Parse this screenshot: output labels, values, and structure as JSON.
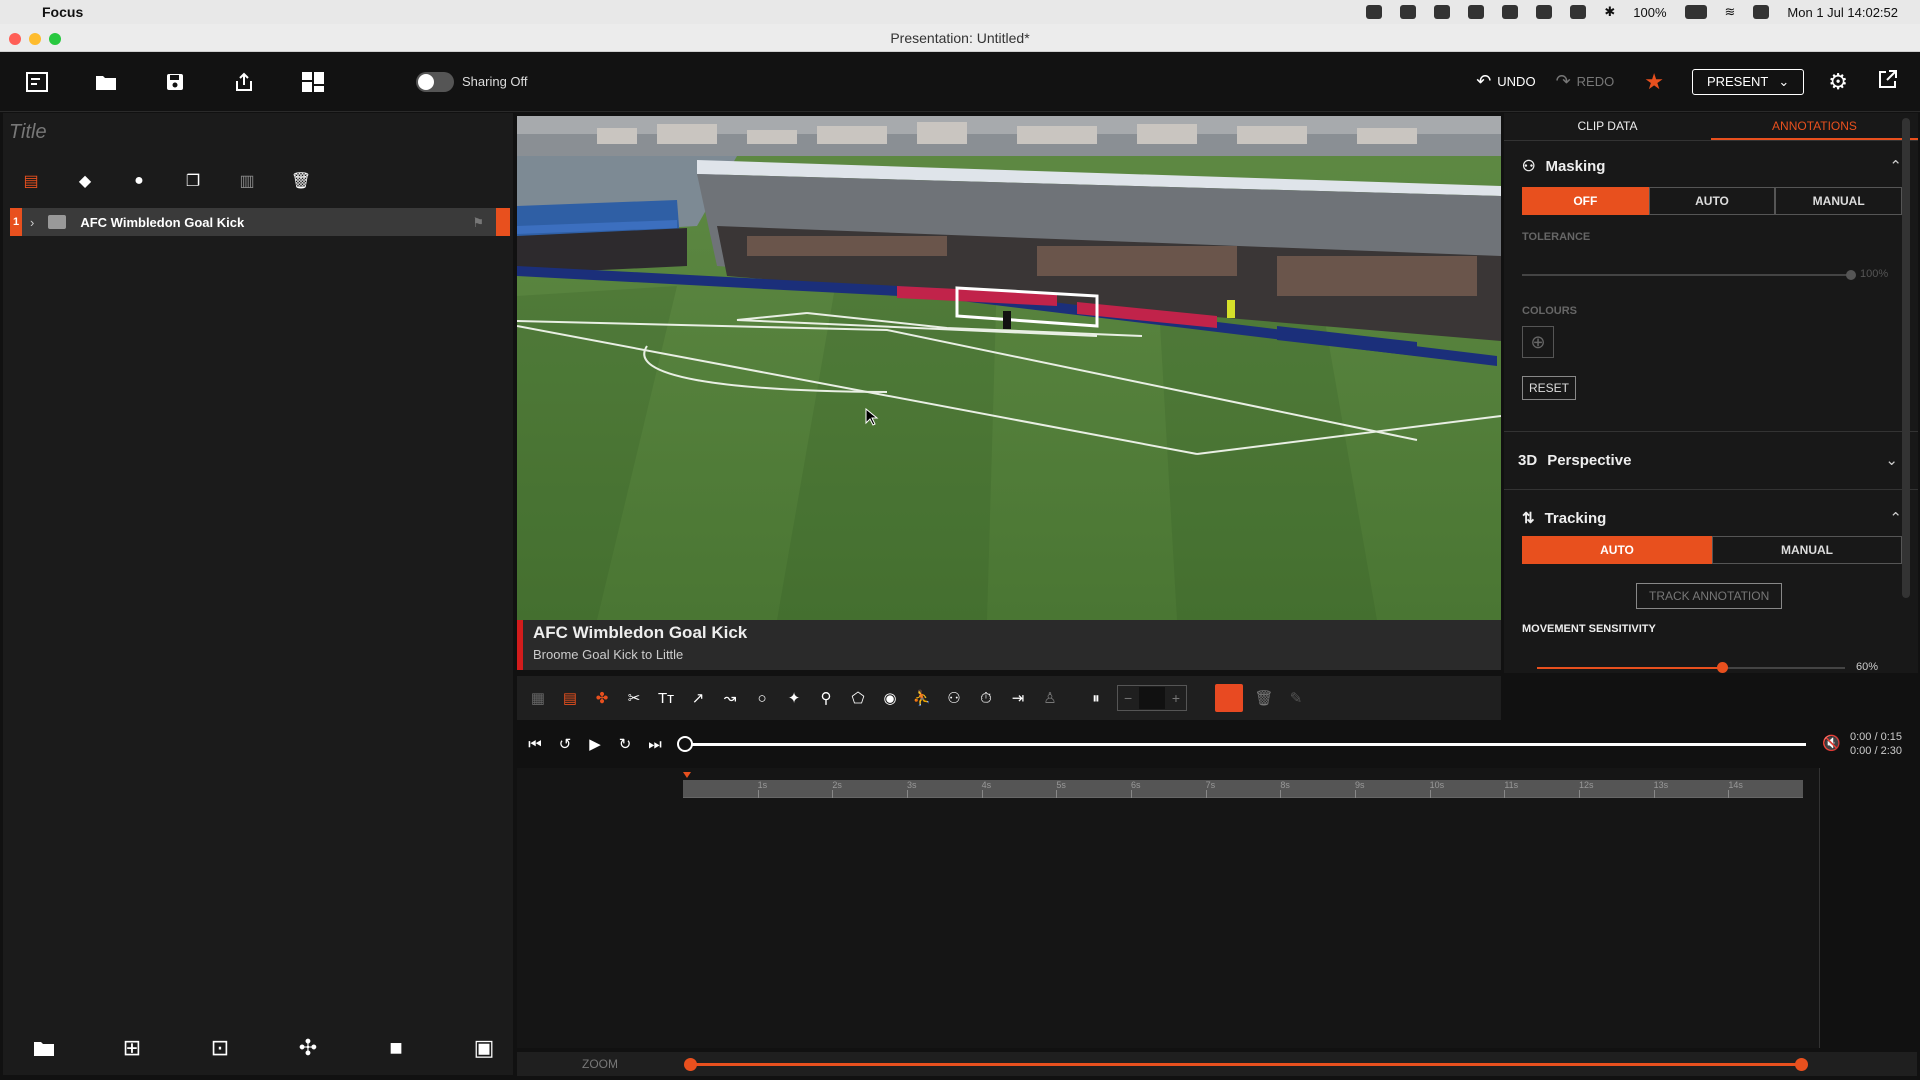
{
  "menubar": {
    "app_name": "Focus",
    "battery": "100%",
    "datetime": "Mon 1 Jul  14:02:52"
  },
  "window": {
    "title": "Presentation: Untitled*"
  },
  "toolbar": {
    "sharing_label": "Sharing Off",
    "undo_label": "UNDO",
    "redo_label": "REDO",
    "present_label": "PRESENT"
  },
  "left_panel": {
    "title_placeholder": "Title",
    "clip": {
      "number": "1",
      "title": "AFC Wimbledon Goal Kick"
    }
  },
  "video": {
    "caption_title": "AFC Wimbledon Goal Kick",
    "caption_subtitle": "Broome Goal Kick to Little"
  },
  "transport": {
    "time_current": "0:00 / 0:15",
    "time_total": "0:00 / 2:30",
    "playhead_fraction": 0.0
  },
  "ruler": {
    "ticks": [
      "1s",
      "2s",
      "3s",
      "4s",
      "5s",
      "6s",
      "7s",
      "8s",
      "9s",
      "10s",
      "11s",
      "12s",
      "13s",
      "14s"
    ]
  },
  "zoom": {
    "label": "ZOOM",
    "range": [
      0.0,
      1.0
    ]
  },
  "right_panel": {
    "tabs": [
      "CLIP DATA",
      "ANNOTATIONS"
    ],
    "active_tab": "ANNOTATIONS",
    "masking": {
      "title": "Masking",
      "modes": [
        "OFF",
        "AUTO",
        "MANUAL"
      ],
      "selected": "OFF",
      "tolerance_label": "TOLERANCE",
      "tolerance_value": "100%",
      "colours_label": "COLOURS",
      "reset_label": "RESET"
    },
    "perspective": {
      "title": "Perspective"
    },
    "tracking": {
      "title": "Tracking",
      "modes": [
        "AUTO",
        "MANUAL"
      ],
      "selected": "AUTO",
      "track_button": "TRACK ANNOTATION",
      "sensitivity_label": "MOVEMENT SENSITIVITY",
      "sensitivity_value": "60%",
      "sensitivity_fraction": 0.6
    }
  },
  "colors": {
    "accent": "#e8501e",
    "caption_bar": "#d21c1c"
  }
}
